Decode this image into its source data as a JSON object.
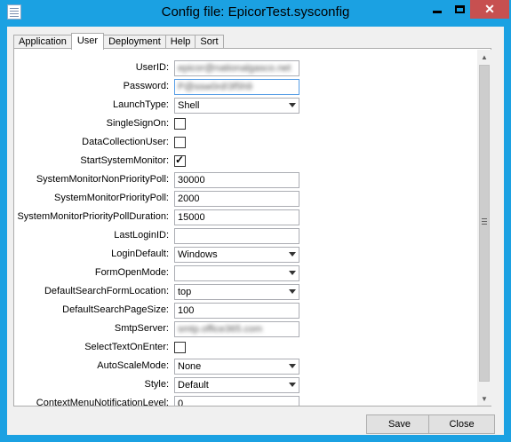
{
  "window": {
    "title": "Config file: EpicorTest.sysconfig",
    "close_glyph": "✕"
  },
  "tabs": [
    {
      "label": "Application",
      "active": false
    },
    {
      "label": "User",
      "active": true
    },
    {
      "label": "Deployment",
      "active": false
    },
    {
      "label": "Help",
      "active": false
    },
    {
      "label": "Sort",
      "active": false
    }
  ],
  "fields": {
    "user_id": {
      "label": "UserID:",
      "value": "epicor@nationalgasco.net"
    },
    "password": {
      "label": "Password:",
      "value": "P@ssw0rd!3f5h9"
    },
    "launch_type": {
      "label": "LaunchType:",
      "value": "Shell"
    },
    "single_sign_on": {
      "label": "SingleSignOn:",
      "checked": false
    },
    "data_collection_user": {
      "label": "DataCollectionUser:",
      "checked": false
    },
    "start_system_monitor": {
      "label": "StartSystemMonitor:",
      "checked": true,
      "check_glyph": "✓"
    },
    "sm_non_priority_poll": {
      "label": "SystemMonitorNonPriorityPoll:",
      "value": "30000"
    },
    "sm_priority_poll": {
      "label": "SystemMonitorPriorityPoll:",
      "value": "2000"
    },
    "sm_priority_poll_duration": {
      "label": "SystemMonitorPriorityPollDuration:",
      "value": "15000"
    },
    "last_login_id": {
      "label": "LastLoginID:",
      "value": ""
    },
    "login_default": {
      "label": "LoginDefault:",
      "value": "Windows"
    },
    "form_open_mode": {
      "label": "FormOpenMode:",
      "value": ""
    },
    "default_search_form_location": {
      "label": "DefaultSearchFormLocation:",
      "value": "top"
    },
    "default_search_page_size": {
      "label": "DefaultSearchPageSize:",
      "value": "100"
    },
    "smtp_server": {
      "label": "SmtpServer:",
      "value": "smtp.office365.com"
    },
    "select_text_on_enter": {
      "label": "SelectTextOnEnter:",
      "checked": false
    },
    "auto_scale_mode": {
      "label": "AutoScaleMode:",
      "value": "None"
    },
    "style": {
      "label": "Style:",
      "value": "Default"
    },
    "context_menu_next": {
      "label": "ContextMenuNotificationLevel:",
      "value": "0"
    }
  },
  "scrollbar": {
    "up_glyph": "▲",
    "down_glyph": "▼"
  },
  "buttons": {
    "save": "Save",
    "close": "Close"
  }
}
